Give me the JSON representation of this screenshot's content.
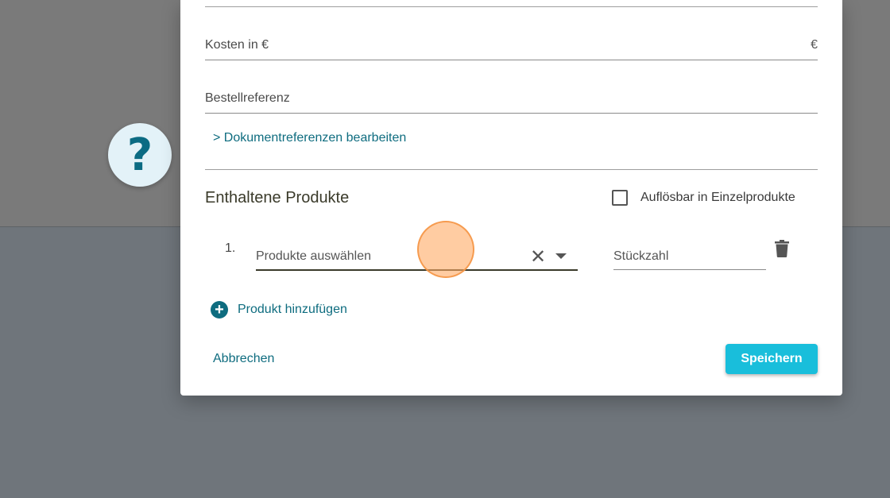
{
  "dialog": {
    "fields": {
      "cost_label": "Kosten in €",
      "cost_suffix": "€",
      "order_ref_label": "Bestellreferenz"
    },
    "doc_refs_link": "> Dokumentreferenzen bearbeiten",
    "products_section": {
      "title": "Enthaltene Produkte",
      "resolvable_checkbox_label": "Auflösbar in Einzelprodukte",
      "resolvable_checked": false,
      "rows": [
        {
          "index": "1.",
          "select_placeholder": "Produkte auswählen",
          "quantity_placeholder": "Stückzahl"
        }
      ],
      "add_product_label": "Produkt hinzufügen"
    },
    "actions": {
      "cancel_label": "Abbrechen",
      "save_label": "Speichern"
    }
  },
  "help_button": {
    "icon": "help-icon",
    "glyph": "?"
  },
  "colors": {
    "accent": "#0e6c7f",
    "primary_button": "#19bedb"
  }
}
